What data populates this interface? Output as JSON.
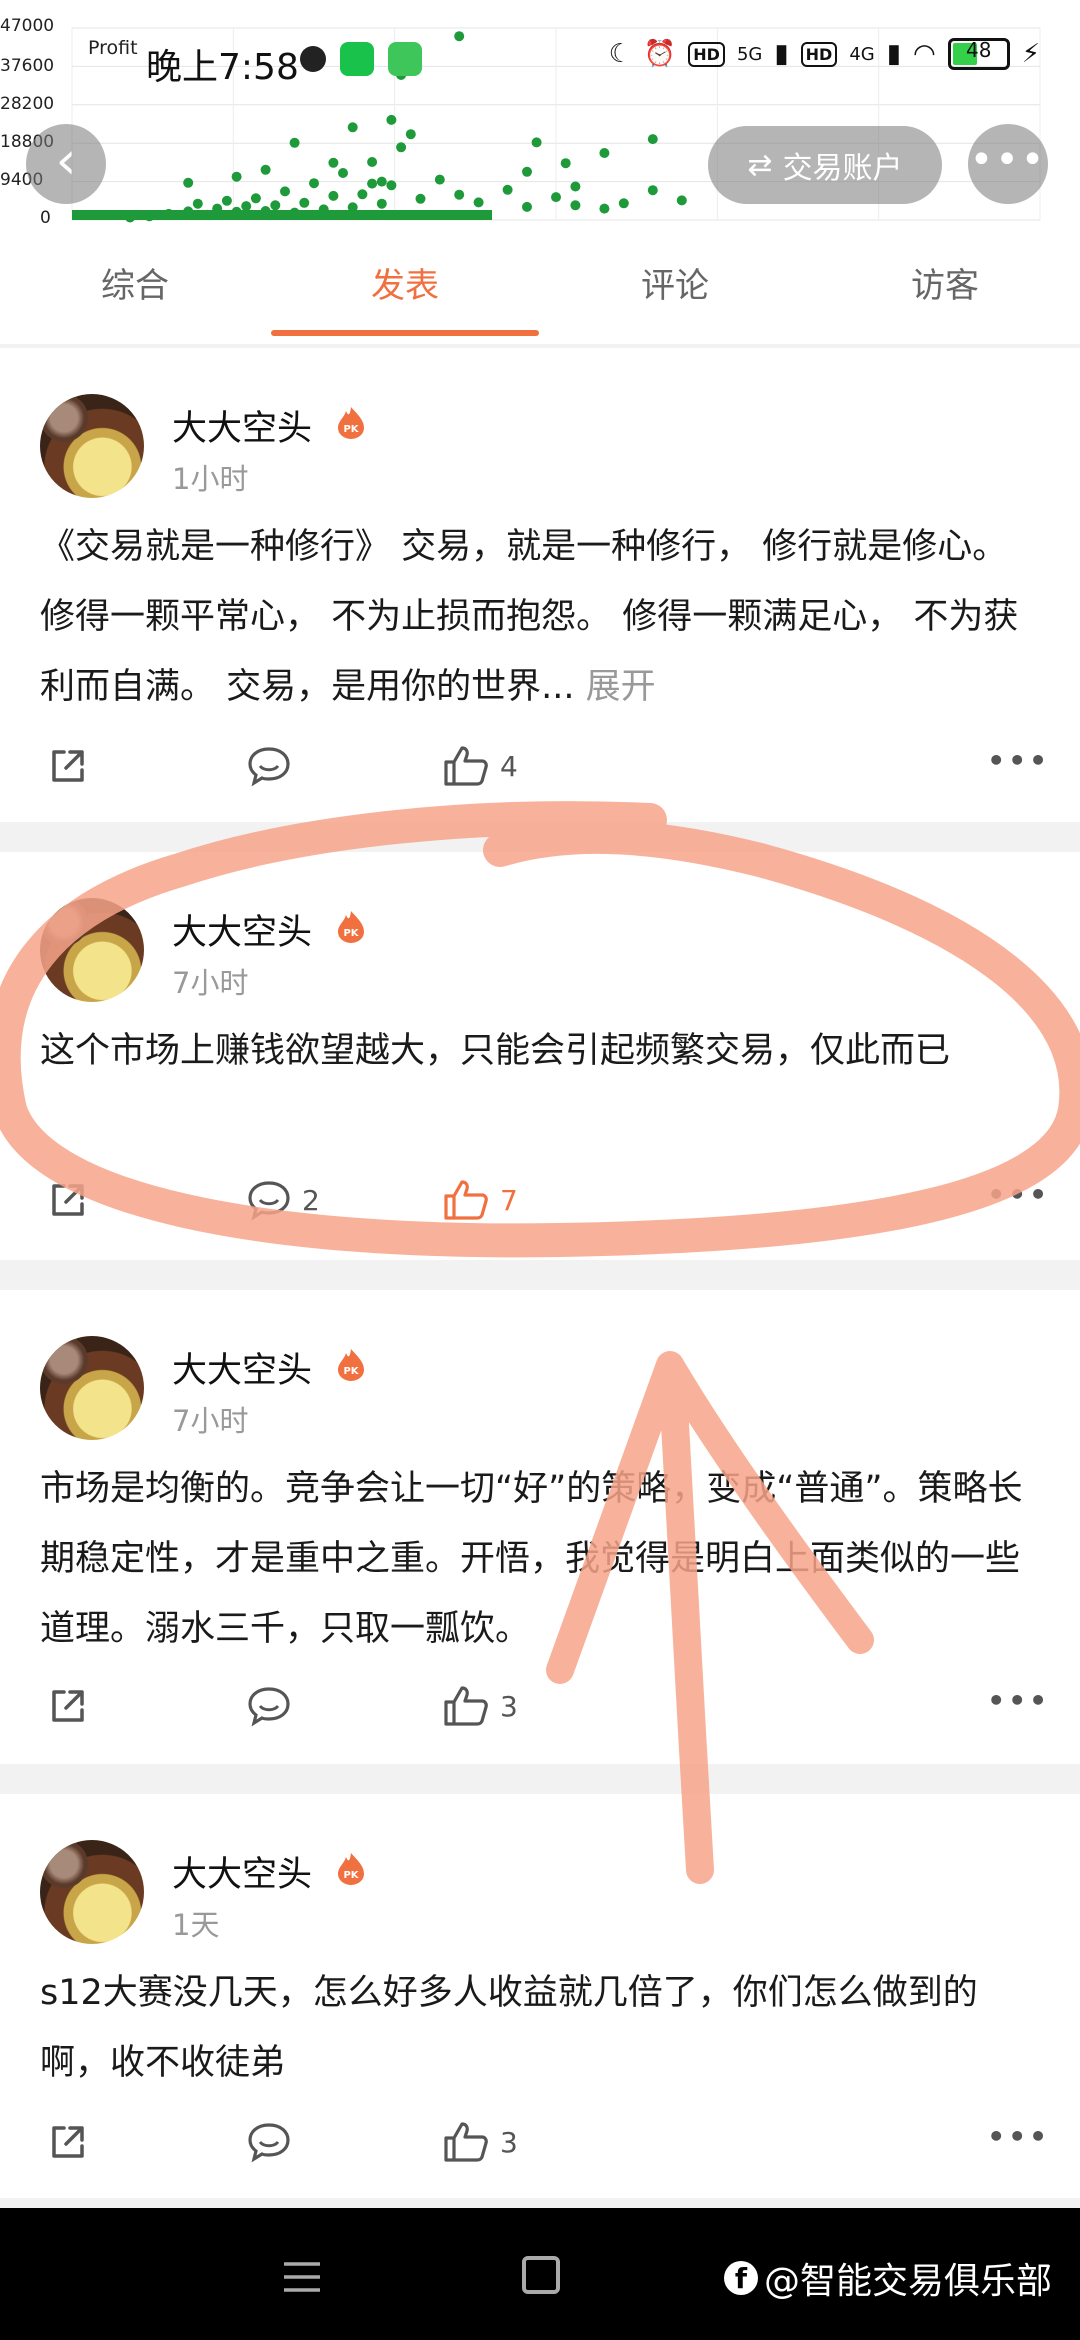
{
  "status_bar": {
    "time": "晚上7:58",
    "net_5g": "5G",
    "net_4g": "4G",
    "hd_label": "HD",
    "battery": "48",
    "battery_level": 0.48
  },
  "chart_data": {
    "type": "scatter",
    "title": "Profit",
    "ylabel": "",
    "y_ticks": [
      "47000",
      "37600",
      "28200",
      "18800",
      "9400",
      "0"
    ],
    "ylim": [
      0,
      47000
    ],
    "x": [
      0.06,
      0.08,
      0.1,
      0.12,
      0.13,
      0.14,
      0.15,
      0.16,
      0.17,
      0.18,
      0.19,
      0.2,
      0.21,
      0.22,
      0.23,
      0.24,
      0.25,
      0.26,
      0.27,
      0.28,
      0.29,
      0.3,
      0.31,
      0.32,
      0.33,
      0.34,
      0.36,
      0.38,
      0.4,
      0.42,
      0.45,
      0.47,
      0.5,
      0.52,
      0.55,
      0.57,
      0.6,
      0.63,
      0.12,
      0.17,
      0.2,
      0.23,
      0.27,
      0.29,
      0.33,
      0.35,
      0.48,
      0.51,
      0.34,
      0.4,
      0.6,
      0.47,
      0.52,
      0.32,
      0.31,
      0.55
    ],
    "values": [
      600,
      900,
      1500,
      2100,
      4000,
      1300,
      2800,
      4700,
      2000,
      3400,
      5300,
      2200,
      3600,
      7000,
      1800,
      4200,
      9000,
      2600,
      5900,
      11500,
      3100,
      6300,
      14200,
      4000,
      8500,
      17800,
      5200,
      9900,
      6200,
      4300,
      7400,
      3200,
      5600,
      3600,
      2800,
      4100,
      7300,
      4800,
      9100,
      10600,
      12300,
      18900,
      14000,
      22700,
      24500,
      21000,
      19000,
      13900,
      35500,
      45000,
      19800,
      11800,
      8200,
      9400,
      8900,
      16400
    ],
    "grid": true
  },
  "header": {
    "back_glyph": "‹",
    "trade_account_label": "交易账户",
    "more_glyph": "•••"
  },
  "tabs": [
    {
      "label": "综合"
    },
    {
      "label": "发表"
    },
    {
      "label": "评论"
    },
    {
      "label": "访客"
    }
  ],
  "posts": [
    {
      "author": "大大空头",
      "time": "1小时",
      "text": "《交易就是一种修行》 交易，就是一种修行， 修行就是修心。 修得一颗平常心， 不为止损而抱怨。 修得一颗满足心， 不为获利而自满。 交易，是用你的世界...",
      "expand": "展开",
      "comments": "",
      "likes": "4",
      "liked": false
    },
    {
      "author": "大大空头",
      "time": "7小时",
      "text": "这个市场上赚钱欲望越大，只能会引起频繁交易，仅此而已",
      "comments": "2",
      "likes": "7",
      "liked": true
    },
    {
      "author": "大大空头",
      "time": "7小时",
      "text": "市场是均衡的。竞争会让一切“好”的策略，变成“普通”。策略长期稳定性，才是重中之重。开悟，我觉得是明白上面类似的一些道理。溺水三千，只取一瓢饮。",
      "comments": "",
      "likes": "3",
      "liked": false
    },
    {
      "author": "大大空头",
      "time": "1天",
      "text": "s12大赛没几天，怎么好多人收益就几倍了，你们怎么做到的啊，收不收徒弟",
      "comments": "",
      "likes": "3",
      "liked": false
    }
  ],
  "badge_text": "PK",
  "watermark": {
    "logo": "f",
    "text": "@智能交易俱乐部"
  },
  "colors": {
    "accent": "#f07040",
    "chart_point": "#1e9a3a",
    "annotation": "#f7a48a"
  }
}
